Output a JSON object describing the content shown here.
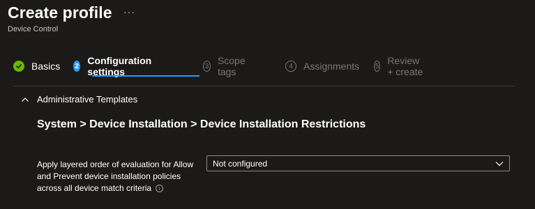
{
  "header": {
    "title": "Create profile",
    "more_icon": "···",
    "subtitle": "Device Control"
  },
  "wizard": {
    "steps": [
      {
        "number": "1",
        "label": "Basics",
        "state": "done"
      },
      {
        "number": "2",
        "label": "Configuration settings",
        "state": "active"
      },
      {
        "number": "3",
        "label": "Scope tags",
        "state": "pending"
      },
      {
        "number": "4",
        "label": "Assignments",
        "state": "pending"
      },
      {
        "number": "5",
        "label": "Review + create",
        "state": "pending"
      }
    ]
  },
  "section": {
    "label": "Administrative Templates",
    "path": "System > Device Installation > Device Installation Restrictions"
  },
  "setting": {
    "label": "Apply layered order of evaluation for Allow and Prevent device installation policies across all device match criteria",
    "info_icon": "i",
    "dropdown_value": "Not configured"
  },
  "colors": {
    "background": "#1b1a19",
    "accent": "#2899f5",
    "success": "#6bb700",
    "muted": "#797775"
  }
}
